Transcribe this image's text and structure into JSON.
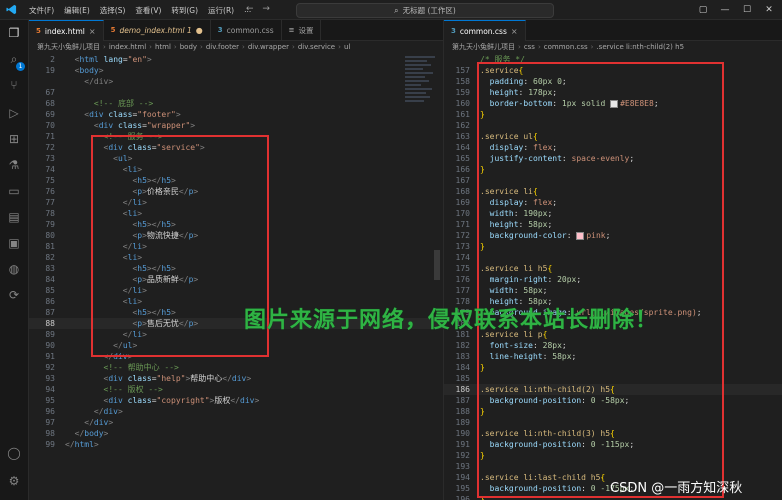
{
  "titlebar": {
    "menu": [
      "文件(F)",
      "编辑(E)",
      "选择(S)",
      "查看(V)",
      "转到(G)",
      "运行(R)",
      "..."
    ],
    "nav_back": "←",
    "nav_forward": "→",
    "search_text": "无标题 (工作区)"
  },
  "left_editor": {
    "tabs": [
      {
        "icon": "5",
        "name": "index.html",
        "close": "×",
        "active": true
      },
      {
        "icon": "5",
        "name": "demo_index.html 1",
        "close": "●",
        "active": false,
        "modified": true
      },
      {
        "icon": "3",
        "name": "common.css",
        "close": "",
        "active": false
      },
      {
        "icon": "≡",
        "name": "设置",
        "close": "",
        "active": false
      }
    ],
    "breadcrumb": [
      "第九天小兔鲜儿项目",
      "index.html",
      "html",
      "body",
      "div.footer",
      "div.wrapper",
      "div.service",
      "ul"
    ],
    "lines": [
      {
        "n": "2",
        "indent": "  ",
        "html": "html_lang"
      },
      {
        "n": "19",
        "indent": "  ",
        "html": "body_open"
      },
      {
        "n": "67",
        "indent": "",
        "html": "blank"
      },
      {
        "n": "68",
        "indent": "      ",
        "html": "c_bottom"
      },
      {
        "n": "69",
        "indent": "    ",
        "html": "footer"
      },
      {
        "n": "70",
        "indent": "      ",
        "html": "wrapper"
      },
      {
        "n": "71",
        "indent": "        ",
        "html": "c_service"
      },
      {
        "n": "72",
        "indent": "        ",
        "html": "service"
      },
      {
        "n": "73",
        "indent": "          ",
        "html": "ul_open"
      },
      {
        "n": "74",
        "indent": "            ",
        "html": "li_open"
      },
      {
        "n": "75",
        "indent": "              ",
        "html": "h5"
      },
      {
        "n": "76",
        "indent": "              ",
        "html": "p1"
      },
      {
        "n": "77",
        "indent": "            ",
        "html": "li_close"
      },
      {
        "n": "78",
        "indent": "            ",
        "html": "li_open"
      },
      {
        "n": "79",
        "indent": "              ",
        "html": "h5"
      },
      {
        "n": "80",
        "indent": "              ",
        "html": "p2"
      },
      {
        "n": "81",
        "indent": "            ",
        "html": "li_close"
      },
      {
        "n": "82",
        "indent": "            ",
        "html": "li_open"
      },
      {
        "n": "83",
        "indent": "              ",
        "html": "h5"
      },
      {
        "n": "84",
        "indent": "              ",
        "html": "p3"
      },
      {
        "n": "85",
        "indent": "            ",
        "html": "li_close"
      },
      {
        "n": "86",
        "indent": "            ",
        "html": "li_open"
      },
      {
        "n": "87",
        "indent": "              ",
        "html": "h5"
      },
      {
        "n": "88",
        "indent": "              ",
        "html": "p4"
      },
      {
        "n": "89",
        "indent": "            ",
        "html": "li_close"
      },
      {
        "n": "90",
        "indent": "          ",
        "html": "ul_close"
      },
      {
        "n": "91",
        "indent": "        ",
        "html": "div_close"
      },
      {
        "n": "92",
        "indent": "        ",
        "html": "c_help"
      },
      {
        "n": "93",
        "indent": "        ",
        "html": "help"
      },
      {
        "n": "94",
        "indent": "        ",
        "html": "c_copy"
      },
      {
        "n": "95",
        "indent": "        ",
        "html": "copyright"
      },
      {
        "n": "96",
        "indent": "      ",
        "html": "div_close"
      },
      {
        "n": "97",
        "indent": "    ",
        "html": "div_close"
      },
      {
        "n": "98",
        "indent": "  ",
        "html": "body_close"
      },
      {
        "n": "99",
        "indent": "",
        "html": "html_close"
      }
    ],
    "text": {
      "lang_attr": "lang",
      "lang_val": "\"en\"",
      "comment_bottom": "<!-- 底部 -->",
      "comment_service": "<!-- 服务 -->",
      "comment_help": "<!-- 帮助中心 -->",
      "comment_copy": "<!-- 版权 -->",
      "footer_class": "\"footer\"",
      "wrapper_class": "\"wrapper\"",
      "service_class": "\"service\"",
      "help_class": "\"help\"",
      "copyright_class": "\"copyright\"",
      "p1": "价格亲民",
      "p2": "物流快捷",
      "p3": "品质新鲜",
      "p4": "售后无忧",
      "help_text": "帮助中心",
      "copy_text": "版权",
      "partial_div": "</div>"
    }
  },
  "right_editor": {
    "tabs": [
      {
        "icon": "3",
        "name": "common.css",
        "close": "×",
        "active": true
      }
    ],
    "breadcrumb": [
      "第九天小兔鲜儿项目",
      "css",
      "common.css",
      ".service li:nth-child(2) h5"
    ],
    "top_comment": "/* 服务 */",
    "lines": [
      {
        "n": "157",
        "sel": ".service",
        "brace": "{"
      },
      {
        "n": "158",
        "prop": "padding",
        "val": "60px 0"
      },
      {
        "n": "159",
        "prop": "height",
        "val": "178px"
      },
      {
        "n": "160",
        "prop": "border-bottom",
        "val": "1px solid",
        "swatch": "#E8E8E8",
        "val2": "#E8E8E8"
      },
      {
        "n": "161",
        "close": "}"
      },
      {
        "n": "162",
        "blank": true
      },
      {
        "n": "163",
        "sel": ".service ul",
        "brace": "{"
      },
      {
        "n": "164",
        "prop": "display",
        "val": "flex"
      },
      {
        "n": "165",
        "prop": "justify-content",
        "val": "space-evenly"
      },
      {
        "n": "166",
        "close": "}"
      },
      {
        "n": "167",
        "blank": true
      },
      {
        "n": "168",
        "sel": ".service li",
        "brace": "{"
      },
      {
        "n": "169",
        "prop": "display",
        "val": "flex"
      },
      {
        "n": "170",
        "prop": "width",
        "val": "190px"
      },
      {
        "n": "171",
        "prop": "height",
        "val": "58px"
      },
      {
        "n": "172",
        "prop": "background-color",
        "val": "",
        "swatch": "pink",
        "val2": "pink"
      },
      {
        "n": "173",
        "close": "}"
      },
      {
        "n": "174",
        "blank": true
      },
      {
        "n": "175",
        "sel": ".service li h5",
        "brace": "{"
      },
      {
        "n": "176",
        "prop": "margin-right",
        "val": "20px"
      },
      {
        "n": "177",
        "prop": "width",
        "val": "58px"
      },
      {
        "n": "178",
        "prop": "height",
        "val": "58px"
      },
      {
        "n": "179",
        "prop": "background-image",
        "val": "url(../images/sprite.png)"
      },
      {
        "n": "180",
        "close": "}"
      },
      {
        "n": "181",
        "sel": ".service li p",
        "brace": "{"
      },
      {
        "n": "182",
        "prop": "font-size",
        "val": "28px"
      },
      {
        "n": "183",
        "prop": "line-height",
        "val": "58px"
      },
      {
        "n": "184",
        "close": "}"
      },
      {
        "n": "185",
        "blank": true
      },
      {
        "n": "186",
        "sel": ".service li:nth-child(2) h5",
        "brace": "{",
        "cur": true
      },
      {
        "n": "187",
        "prop": "background-position",
        "val": "0 -58px"
      },
      {
        "n": "188",
        "close": "}"
      },
      {
        "n": "189",
        "blank": true
      },
      {
        "n": "190",
        "sel": ".service li:nth-child(3) h5",
        "brace": "{"
      },
      {
        "n": "191",
        "prop": "background-position",
        "val": "0 -115px"
      },
      {
        "n": "192",
        "close": "}"
      },
      {
        "n": "193",
        "blank": true
      },
      {
        "n": "194",
        "sel": ".service li:last-child h5",
        "brace": "{"
      },
      {
        "n": "195",
        "prop": "background-position",
        "val": "0 -175px"
      },
      {
        "n": "196",
        "close": "}"
      }
    ]
  },
  "watermark": "图片来源于网络，侵权联系本站长删除！",
  "csdn_credit": "CSDN @一雨方知深秋",
  "activity_badge": "1",
  "colors": {
    "accent": "#0078d4",
    "highlight_box": "#e03131",
    "watermark": "#2fb344"
  }
}
